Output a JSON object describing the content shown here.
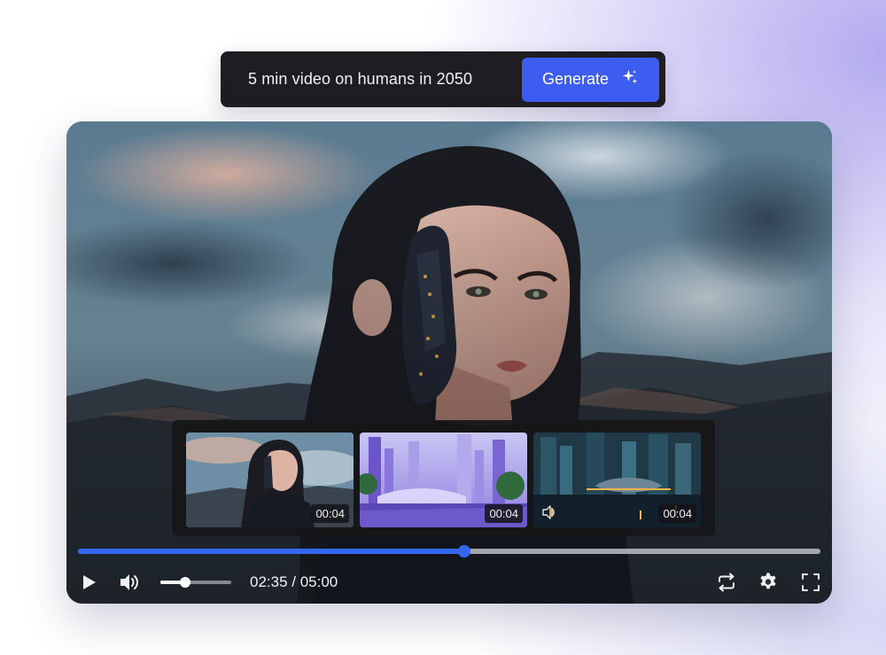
{
  "prompt_bar": {
    "prompt_text": "5 min video on humans in 2050",
    "generate_label": "Generate",
    "generate_icon": "sparkles-icon",
    "accent_color": "#3d5cf0"
  },
  "player": {
    "thumbnails": [
      {
        "duration": "00:04",
        "selected": true,
        "has_audio_icon": false
      },
      {
        "duration": "00:04",
        "selected": false,
        "has_audio_icon": false
      },
      {
        "duration": "00:04",
        "selected": false,
        "has_audio_icon": true
      }
    ],
    "progress_fraction": 0.52,
    "progress_color": "#3367f0",
    "volume_fraction": 0.35,
    "current_time": "02:35",
    "total_time": "05:00",
    "time_readout": "02:35 / 05:00",
    "icons": {
      "play": "play-icon",
      "volume": "volume-icon",
      "loop": "loop-icon",
      "settings": "gear-icon",
      "fullscreen": "fullscreen-icon"
    }
  }
}
